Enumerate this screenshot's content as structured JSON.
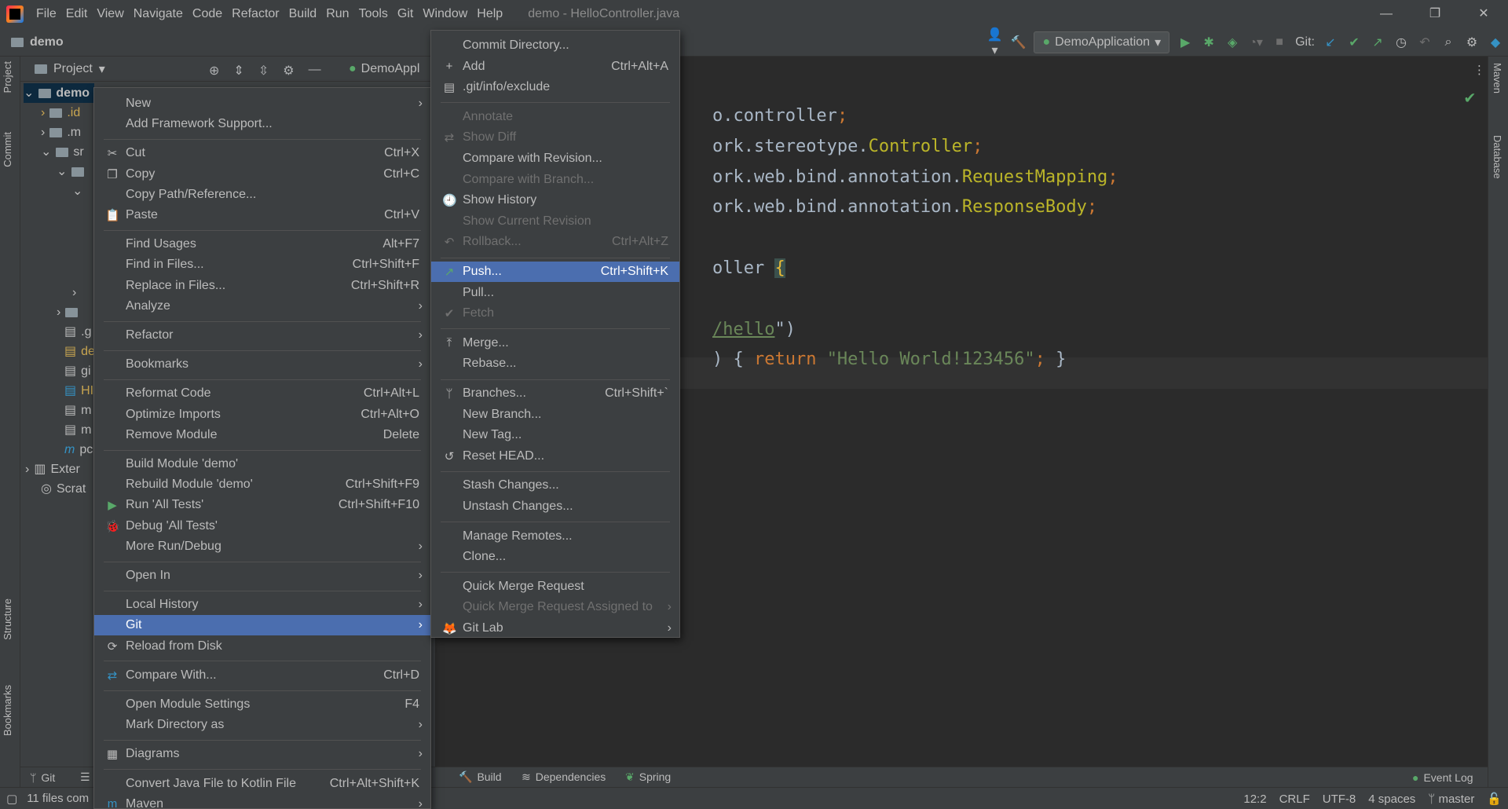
{
  "window": {
    "menu": [
      "File",
      "Edit",
      "View",
      "Navigate",
      "Code",
      "Refactor",
      "Build",
      "Run",
      "Tools",
      "Git",
      "Window",
      "Help"
    ],
    "title": "demo - HelloController.java",
    "controls": [
      "—",
      "❐",
      "✕"
    ]
  },
  "navbar": {
    "project_name": "demo",
    "run_config": "DemoApplication",
    "git_label": "Git:"
  },
  "side_tabs": {
    "left": [
      "Project",
      "Commit",
      "Structure",
      "Bookmarks"
    ],
    "right": [
      "Maven",
      "Database"
    ]
  },
  "project_panel": {
    "title": "Project",
    "tree": [
      {
        "label": "demo",
        "color": "#bbbbbb"
      },
      {
        "label": ".id",
        "color": "#c9a651"
      },
      {
        "label": ".m",
        "color": "#bbbbbb"
      },
      {
        "label": "sr",
        "color": "#bbbbbb"
      },
      {
        "label": ".g",
        "color": "#bbbbbb"
      },
      {
        "label": "de",
        "color": "#c9a651"
      },
      {
        "label": "gi",
        "color": "#bbbbbb"
      },
      {
        "label": "HI",
        "color": "#c9a651"
      },
      {
        "label": "m",
        "color": "#bbbbbb"
      },
      {
        "label": "m",
        "color": "#bbbbbb"
      },
      {
        "label": "pc",
        "color": "#bbbbbb"
      },
      {
        "label": "Exter",
        "color": "#bbbbbb"
      },
      {
        "label": "Scrat",
        "color": "#bbbbbb"
      }
    ]
  },
  "editor": {
    "tab_label": "DemoAppl",
    "lines": [
      {
        "parts": [
          {
            "t": "o.controller",
            "c": "plain"
          },
          {
            "t": ";",
            "c": "kw"
          }
        ]
      },
      {
        "parts": [
          {
            "t": "ork.stereotype.",
            "c": "plain"
          },
          {
            "t": "Controller",
            "c": "ann"
          },
          {
            "t": ";",
            "c": "kw"
          }
        ]
      },
      {
        "parts": [
          {
            "t": "ork.web.bind.annotation.",
            "c": "plain"
          },
          {
            "t": "RequestMapping",
            "c": "ann"
          },
          {
            "t": ";",
            "c": "kw"
          }
        ]
      },
      {
        "parts": [
          {
            "t": "ork.web.bind.annotation.",
            "c": "plain"
          },
          {
            "t": "ResponseBody",
            "c": "ann"
          },
          {
            "t": ";",
            "c": "kw"
          }
        ]
      },
      {
        "parts": [
          {
            "t": "oller ",
            "c": "plain"
          },
          {
            "t": "{",
            "c": "brace"
          }
        ]
      },
      {
        "parts": [
          {
            "t": "/hello",
            "c": "str"
          },
          {
            "t": "\")",
            "c": "plain"
          }
        ]
      },
      {
        "parts": [
          {
            "t": ") { ",
            "c": "plain"
          },
          {
            "t": "return ",
            "c": "kw"
          },
          {
            "t": "\"Hello World!123456\"",
            "c": "str"
          },
          {
            "t": ";",
            "c": "kw"
          },
          {
            "t": " }",
            "c": "plain"
          }
        ]
      }
    ]
  },
  "context_menu": {
    "items": [
      {
        "label": "New",
        "shortcut": "",
        "submenu": true,
        "icon": ""
      },
      {
        "label": "Add Framework Support...",
        "shortcut": "",
        "submenu": false,
        "icon": ""
      },
      {
        "sep": true
      },
      {
        "label": "Cut",
        "shortcut": "Ctrl+X",
        "submenu": false,
        "icon": "✂"
      },
      {
        "label": "Copy",
        "shortcut": "Ctrl+C",
        "submenu": false,
        "icon": "❐"
      },
      {
        "label": "Copy Path/Reference...",
        "shortcut": "",
        "submenu": false,
        "icon": ""
      },
      {
        "label": "Paste",
        "shortcut": "Ctrl+V",
        "submenu": false,
        "icon": "📋"
      },
      {
        "sep": true
      },
      {
        "label": "Find Usages",
        "shortcut": "Alt+F7",
        "submenu": false,
        "icon": ""
      },
      {
        "label": "Find in Files...",
        "shortcut": "Ctrl+Shift+F",
        "submenu": false,
        "icon": ""
      },
      {
        "label": "Replace in Files...",
        "shortcut": "Ctrl+Shift+R",
        "submenu": false,
        "icon": ""
      },
      {
        "label": "Analyze",
        "shortcut": "",
        "submenu": true,
        "icon": ""
      },
      {
        "sep": true
      },
      {
        "label": "Refactor",
        "shortcut": "",
        "submenu": true,
        "icon": ""
      },
      {
        "sep": true
      },
      {
        "label": "Bookmarks",
        "shortcut": "",
        "submenu": true,
        "icon": ""
      },
      {
        "sep": true
      },
      {
        "label": "Reformat Code",
        "shortcut": "Ctrl+Alt+L",
        "submenu": false,
        "icon": ""
      },
      {
        "label": "Optimize Imports",
        "shortcut": "Ctrl+Alt+O",
        "submenu": false,
        "icon": ""
      },
      {
        "label": "Remove Module",
        "shortcut": "Delete",
        "submenu": false,
        "icon": ""
      },
      {
        "sep": true
      },
      {
        "label": "Build Module 'demo'",
        "shortcut": "",
        "submenu": false,
        "icon": ""
      },
      {
        "label": "Rebuild Module 'demo'",
        "shortcut": "Ctrl+Shift+F9",
        "submenu": false,
        "icon": ""
      },
      {
        "label": "Run 'All Tests'",
        "shortcut": "Ctrl+Shift+F10",
        "submenu": false,
        "icon": "▶"
      },
      {
        "label": "Debug 'All Tests'",
        "shortcut": "",
        "submenu": false,
        "icon": "🐞"
      },
      {
        "label": "More Run/Debug",
        "shortcut": "",
        "submenu": true,
        "icon": ""
      },
      {
        "sep": true
      },
      {
        "label": "Open In",
        "shortcut": "",
        "submenu": true,
        "icon": ""
      },
      {
        "sep": true
      },
      {
        "label": "Local History",
        "shortcut": "",
        "submenu": true,
        "icon": ""
      },
      {
        "label": "Git",
        "shortcut": "",
        "submenu": true,
        "icon": "",
        "selected": true
      },
      {
        "label": "Reload from Disk",
        "shortcut": "",
        "submenu": false,
        "icon": "⟳"
      },
      {
        "sep": true
      },
      {
        "label": "Compare With...",
        "shortcut": "Ctrl+D",
        "submenu": false,
        "icon": "⇄"
      },
      {
        "sep": true
      },
      {
        "label": "Open Module Settings",
        "shortcut": "F4",
        "submenu": false,
        "icon": ""
      },
      {
        "label": "Mark Directory as",
        "shortcut": "",
        "submenu": true,
        "icon": ""
      },
      {
        "sep": true
      },
      {
        "label": "Diagrams",
        "shortcut": "",
        "submenu": true,
        "icon": "▦"
      },
      {
        "sep": true
      },
      {
        "label": "Convert Java File to Kotlin File",
        "shortcut": "Ctrl+Alt+Shift+K",
        "submenu": false,
        "icon": ""
      },
      {
        "label": "Maven",
        "shortcut": "",
        "submenu": true,
        "icon": "m"
      }
    ]
  },
  "git_menu": {
    "items": [
      {
        "label": "Commit Directory...",
        "shortcut": "",
        "submenu": false,
        "icon": ""
      },
      {
        "label": "Add",
        "shortcut": "Ctrl+Alt+A",
        "submenu": false,
        "icon": "+"
      },
      {
        "label": ".git/info/exclude",
        "shortcut": "",
        "submenu": false,
        "icon": "▤"
      },
      {
        "sep": true
      },
      {
        "label": "Annotate",
        "shortcut": "",
        "submenu": false,
        "icon": "",
        "disabled": true
      },
      {
        "label": "Show Diff",
        "shortcut": "",
        "submenu": false,
        "icon": "⇄",
        "disabled": true
      },
      {
        "label": "Compare with Revision...",
        "shortcut": "",
        "submenu": false,
        "icon": ""
      },
      {
        "label": "Compare with Branch...",
        "shortcut": "",
        "submenu": false,
        "icon": "",
        "disabled": true
      },
      {
        "label": "Show History",
        "shortcut": "",
        "submenu": false,
        "icon": "🕘"
      },
      {
        "label": "Show Current Revision",
        "shortcut": "",
        "submenu": false,
        "icon": "",
        "disabled": true
      },
      {
        "label": "Rollback...",
        "shortcut": "Ctrl+Alt+Z",
        "submenu": false,
        "icon": "↶",
        "disabled": true
      },
      {
        "sep": true
      },
      {
        "label": "Push...",
        "shortcut": "Ctrl+Shift+K",
        "submenu": false,
        "icon": "↗",
        "selected": true
      },
      {
        "label": "Pull...",
        "shortcut": "",
        "submenu": false,
        "icon": ""
      },
      {
        "label": "Fetch",
        "shortcut": "",
        "submenu": false,
        "icon": "✔",
        "disabled": true
      },
      {
        "sep": true
      },
      {
        "label": "Merge...",
        "shortcut": "",
        "submenu": false,
        "icon": "⤒"
      },
      {
        "label": "Rebase...",
        "shortcut": "",
        "submenu": false,
        "icon": ""
      },
      {
        "sep": true
      },
      {
        "label": "Branches...",
        "shortcut": "Ctrl+Shift+`",
        "submenu": false,
        "icon": "ᛘ"
      },
      {
        "label": "New Branch...",
        "shortcut": "",
        "submenu": false,
        "icon": ""
      },
      {
        "label": "New Tag...",
        "shortcut": "",
        "submenu": false,
        "icon": ""
      },
      {
        "label": "Reset HEAD...",
        "shortcut": "",
        "submenu": false,
        "icon": "↺"
      },
      {
        "sep": true
      },
      {
        "label": "Stash Changes...",
        "shortcut": "",
        "submenu": false,
        "icon": ""
      },
      {
        "label": "Unstash Changes...",
        "shortcut": "",
        "submenu": false,
        "icon": ""
      },
      {
        "sep": true
      },
      {
        "label": "Manage Remotes...",
        "shortcut": "",
        "submenu": false,
        "icon": ""
      },
      {
        "label": "Clone...",
        "shortcut": "",
        "submenu": false,
        "icon": ""
      },
      {
        "sep": true
      },
      {
        "label": "Quick Merge Request",
        "shortcut": "",
        "submenu": false,
        "icon": ""
      },
      {
        "label": "Quick Merge Request Assigned to",
        "shortcut": "",
        "submenu": true,
        "icon": "",
        "disabled": true
      },
      {
        "label": "Git Lab",
        "shortcut": "",
        "submenu": true,
        "icon": "🦊"
      }
    ]
  },
  "bottom_tabs": [
    "Git",
    "Build",
    "Dependencies",
    "Spring",
    "Event Log"
  ],
  "status": {
    "left_text": "11 files com",
    "position": "12:2",
    "line_sep": "CRLF",
    "encoding": "UTF-8",
    "indent": "4 spaces",
    "branch": "master"
  },
  "colors": {
    "selection": "#4b6eaf",
    "menu_bg": "#3c3f41",
    "editor_bg": "#2b2b2b"
  }
}
